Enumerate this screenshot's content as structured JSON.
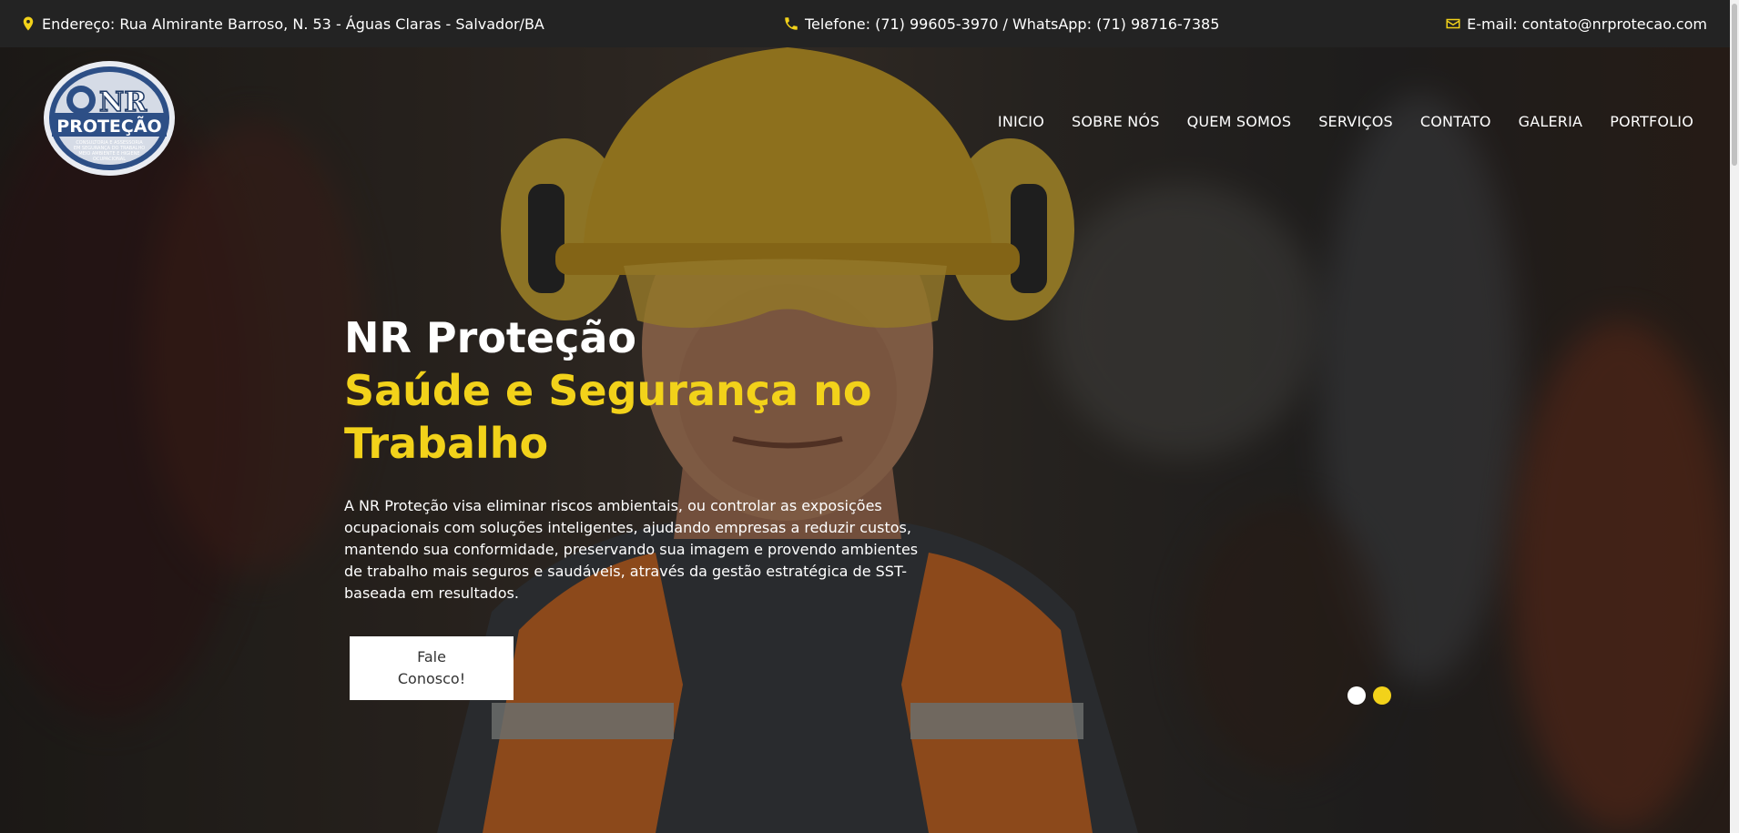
{
  "topbar": {
    "address": "Endereço: Rua Almirante Barroso, N. 53 - Águas Claras - Salvador/BA",
    "phone": "Telefone: (71) 99605-3970 / WhatsApp: (71) 98716-7385",
    "email": "E-mail: contato@nrprotecao.com",
    "icons": [
      "map-pin-icon",
      "phone-icon",
      "envelope-icon"
    ]
  },
  "logo": {
    "line1": "NR",
    "line2": "PROTEÇÃO",
    "tagline1": "CONSULTORIA E ASSESSORIA",
    "tagline2": "EM SEGURANÇA DO TRABALHO",
    "tagline3": "MEIO AMBIENTE E HIGIENE",
    "tagline4": "OCUPACIONAL"
  },
  "nav": {
    "items": [
      {
        "label": "INICIO"
      },
      {
        "label": "SOBRE NÓS"
      },
      {
        "label": "QUEM SOMOS"
      },
      {
        "label": "SERVIÇOS"
      },
      {
        "label": "CONTATO"
      },
      {
        "label": "GALERIA"
      },
      {
        "label": "PORTFOLIO"
      }
    ]
  },
  "hero": {
    "title": "NR Proteção",
    "subtitle": "Saúde e Segurança no Trabalho",
    "description": "A NR Proteção visa eliminar riscos ambientais, ou controlar as exposições ocupacionais com soluções inteligentes, ajudando empresas a reduzir custos, mantendo sua conformidade, preservando sua imagem e provendo ambientes de trabalho mais seguros e saudáveis, através da gestão estratégica de SST- baseada em resultados.",
    "cta_label": "Fale Conosco!"
  },
  "slider": {
    "slides": 2,
    "active_index": 1
  },
  "colors": {
    "accent": "#f2d21a",
    "topbar_bg": "#232323",
    "text": "#ffffff"
  }
}
